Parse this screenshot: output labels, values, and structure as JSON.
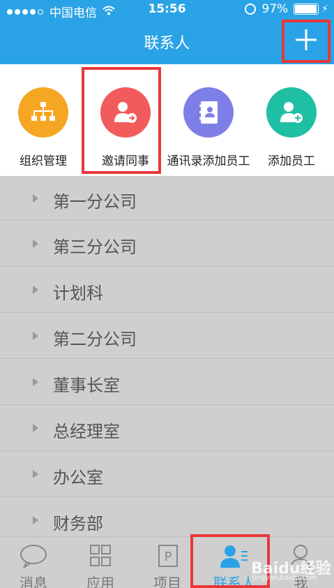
{
  "status_bar": {
    "carrier": "中国电信",
    "time": "15:56",
    "battery_percent": "97%",
    "battery_level": 0.97
  },
  "header": {
    "title": "联系人",
    "add_icon": "plus-icon"
  },
  "actions": [
    {
      "label": "组织管理",
      "icon": "org-chart-icon",
      "color": "#f5a623"
    },
    {
      "label": "邀请同事",
      "icon": "invite-user-icon",
      "color": "#f25b5b"
    },
    {
      "label": "通讯录添加员工",
      "icon": "address-book-icon",
      "color": "#7d7fe6"
    },
    {
      "label": "添加员工",
      "icon": "add-user-icon",
      "color": "#1fbfa3"
    }
  ],
  "departments": [
    "第一分公司",
    "第三分公司",
    "计划科",
    "第二分公司",
    "董事长室",
    "总经理室",
    "办公室",
    "财务部"
  ],
  "tabs": [
    {
      "label": "消息",
      "icon": "chat-icon"
    },
    {
      "label": "应用",
      "icon": "grid-icon"
    },
    {
      "label": "项目",
      "icon": "project-icon"
    },
    {
      "label": "联系人",
      "icon": "contacts-icon",
      "active": true
    },
    {
      "label": "我",
      "icon": "person-icon"
    }
  ],
  "watermark": {
    "text": "Baidu经验",
    "sub": "jingyan.baidu.com"
  },
  "colors": {
    "accent": "#2aa3e6",
    "highlight": "#e8373a"
  }
}
